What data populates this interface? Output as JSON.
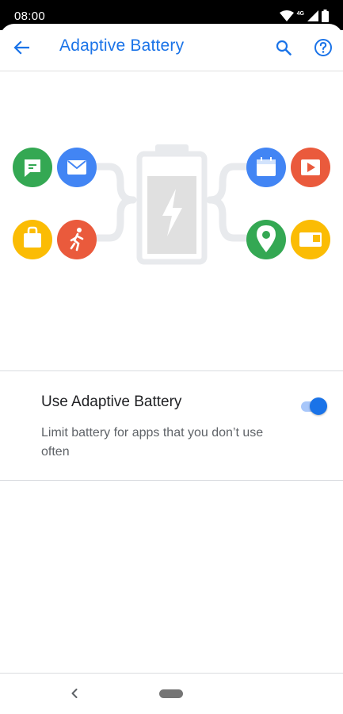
{
  "status_bar": {
    "time": "08:00",
    "network_label": "4G",
    "icons": [
      "wifi-icon",
      "cellular-signal-icon",
      "battery-icon"
    ]
  },
  "app_bar": {
    "title": "Adaptive Battery",
    "icons": [
      "back-arrow-icon",
      "search-icon",
      "help-icon"
    ]
  },
  "illustration": {
    "left_apps": [
      "messages-icon",
      "email-icon",
      "shopping-bag-icon",
      "fitness-icon"
    ],
    "center": "battery-charging-icon",
    "right_apps": [
      "calendar-icon",
      "video-play-icon",
      "maps-icon",
      "ticket-icon"
    ]
  },
  "setting": {
    "title": "Use Adaptive Battery",
    "summary": "Limit battery for apps that you don’t use often",
    "enabled": true
  },
  "nav_bar": {
    "icons": [
      "nav-back-icon",
      "home-pill"
    ]
  },
  "colors": {
    "accent": "#1a73e8",
    "green": "#34a853",
    "blue": "#4285f4",
    "yellow": "#fbbc04",
    "red": "#ea5a3c",
    "connector": "#e8eaed"
  }
}
